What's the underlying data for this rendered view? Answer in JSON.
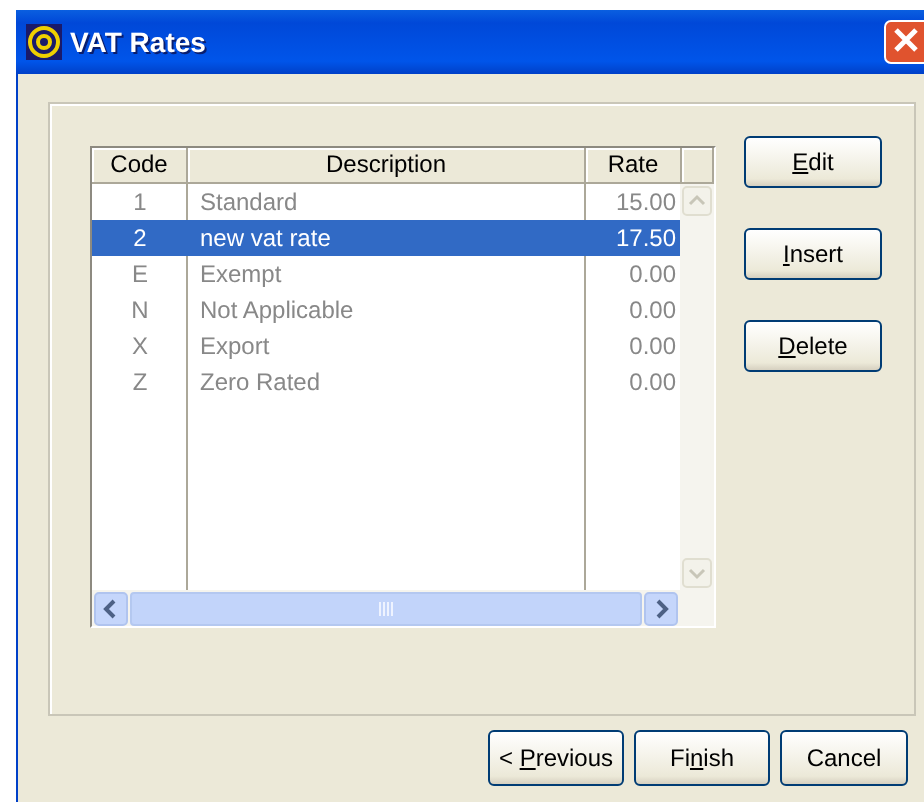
{
  "window": {
    "title": "VAT Rates"
  },
  "table": {
    "columns": [
      "Code",
      "Description",
      "Rate"
    ],
    "rows": [
      {
        "code": "1",
        "description": "Standard",
        "rate": "15.00",
        "selected": false
      },
      {
        "code": "2",
        "description": "new vat rate",
        "rate": "17.50",
        "selected": true
      },
      {
        "code": "E",
        "description": "Exempt",
        "rate": "0.00",
        "selected": false
      },
      {
        "code": "N",
        "description": "Not Applicable",
        "rate": "0.00",
        "selected": false
      },
      {
        "code": "X",
        "description": "Export",
        "rate": "0.00",
        "selected": false
      },
      {
        "code": "Z",
        "description": "Zero Rated",
        "rate": "0.00",
        "selected": false
      }
    ]
  },
  "side_buttons": [
    {
      "key": "E",
      "post": "dit"
    },
    {
      "key": "I",
      "post": "nsert"
    },
    {
      "key": "D",
      "post": "elete"
    }
  ],
  "bottom_buttons": [
    {
      "pre": "< ",
      "key": "P",
      "post": "revious"
    },
    {
      "pre": "Fi",
      "key": "n",
      "post": "ish"
    },
    {
      "pre": "Cancel"
    }
  ]
}
